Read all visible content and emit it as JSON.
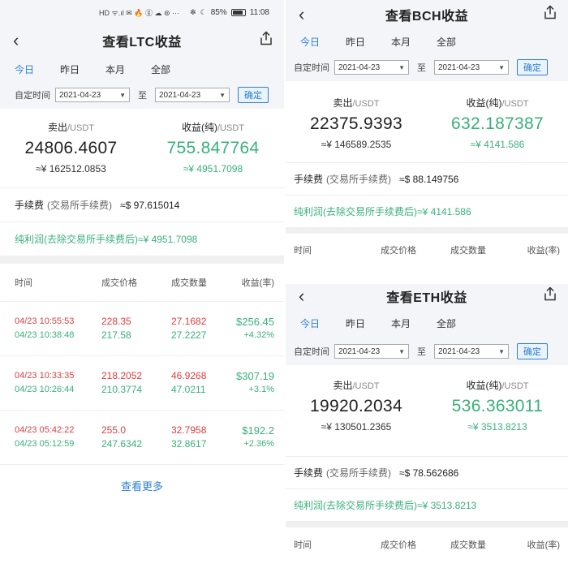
{
  "status_bar": {
    "left_icons": "HD ᯤ.ıl ✉ 🔥 ⓖ ☁ ⊚ ···",
    "bluetooth": "✻",
    "moon": "☾",
    "battery_pct": "85%",
    "time": "11:08"
  },
  "ltc": {
    "title": "查看LTC收益",
    "tabs": [
      "今日",
      "昨日",
      "本月",
      "全部"
    ],
    "active_tab": 0,
    "date_label": "自定时间",
    "date_from": "2021-04-23",
    "date_sep": "至",
    "date_to": "2021-04-23",
    "confirm": "确定",
    "sell_label": "卖出",
    "profit_label": "收益(纯)",
    "unit": "/USDT",
    "sell_value": "24806.4607",
    "sell_cny": "≈¥ 162512.0853",
    "profit_value": "755.847764",
    "profit_cny": "≈¥ 4951.7098",
    "fee_label": "手续费",
    "fee_note": "(交易所手续费)",
    "fee_value": "≈$ 97.615014",
    "net_label": "纯利润(去除交易所手续费后)≈¥ 4951.7098",
    "columns": [
      "时间",
      "成交价格",
      "成交数量",
      "收益(率)"
    ],
    "rows": [
      {
        "t1": "04/23 10:55:53",
        "t2": "04/23 10:38:48",
        "p1": "228.35",
        "p2": "217.58",
        "q1": "27.1682",
        "q2": "27.2227",
        "profit": "$256.45",
        "rate": "+4.32%"
      },
      {
        "t1": "04/23 10:33:35",
        "t2": "04/23 10:26:44",
        "p1": "218.2052",
        "p2": "210.3774",
        "q1": "46.9268",
        "q2": "47.0211",
        "profit": "$307.19",
        "rate": "+3.1%"
      },
      {
        "t1": "04/23 05:42:22",
        "t2": "04/23 05:12:59",
        "p1": "255.0",
        "p2": "247.6342",
        "q1": "32.7958",
        "q2": "32.8617",
        "profit": "$192.2",
        "rate": "+2.36%"
      }
    ],
    "more": "查看更多"
  },
  "bch": {
    "title": "查看BCH收益",
    "tabs": [
      "今日",
      "昨日",
      "本月",
      "全部"
    ],
    "active_tab": 0,
    "date_label": "自定时间",
    "date_from": "2021-04-23",
    "date_sep": "至",
    "date_to": "2021-04-23",
    "confirm": "确定",
    "sell_label": "卖出",
    "profit_label": "收益(纯)",
    "unit": "/USDT",
    "sell_value": "22375.9393",
    "sell_cny": "≈¥ 146589.2535",
    "profit_value": "632.187387",
    "profit_cny": "≈¥ 4141.586",
    "fee_label": "手续费",
    "fee_note": "(交易所手续费)",
    "fee_value": "≈$ 88.149756",
    "net_label": "纯利润(去除交易所手续费后)≈¥ 4141.586",
    "columns": [
      "时间",
      "成交价格",
      "成交数量",
      "收益(率)"
    ]
  },
  "eth": {
    "title": "查看ETH收益",
    "tabs": [
      "今日",
      "昨日",
      "本月",
      "全部"
    ],
    "active_tab": 0,
    "date_label": "自定时间",
    "date_from": "2021-04-23",
    "date_sep": "至",
    "date_to": "2021-04-23",
    "confirm": "确定",
    "sell_label": "卖出",
    "profit_label": "收益(纯)",
    "unit": "/USDT",
    "sell_value": "19920.2034",
    "sell_cny": "≈¥ 130501.2365",
    "profit_value": "536.363011",
    "profit_cny": "≈¥ 3513.8213",
    "fee_label": "手续费",
    "fee_note": "(交易所手续费)",
    "fee_value": "≈$ 78.562686",
    "net_label": "纯利润(去除交易所手续费后)≈¥ 3513.8213",
    "columns": [
      "时间",
      "成交价格",
      "成交数量",
      "收益(率)"
    ]
  },
  "icons": {
    "back": "chevron-left-icon",
    "share": "share-icon",
    "caret": "caret-down-icon"
  },
  "colors": {
    "accent": "#2b7fd4",
    "green": "#39b07a",
    "red": "#d94040"
  }
}
